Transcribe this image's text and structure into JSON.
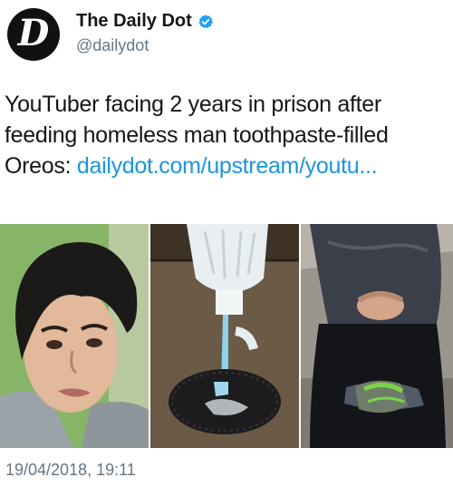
{
  "account": {
    "avatar_letter": "D",
    "display_name": "The Daily Dot",
    "handle": "@dailydot",
    "verified_icon": "verified-badge-icon"
  },
  "tweet": {
    "text_main": "YouTuber facing 2 years in prison after feeding homeless man toothpaste-filled Oreos: ",
    "link_text": "dailydot.com/upstream/youtu..."
  },
  "media": {
    "photos": [
      "selfie-photo",
      "toothpaste-oreo-photo",
      "seated-man-photo"
    ]
  },
  "timestamp": "19/04/2018, 19:11",
  "colors": {
    "link": "#1b95e0",
    "verified": "#1da1f2",
    "muted": "#657786"
  }
}
